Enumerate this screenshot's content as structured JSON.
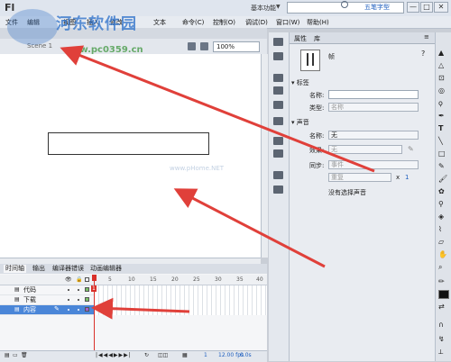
{
  "title_bar": {
    "app_logo": "Fl",
    "workspace": "基本功能",
    "search_label": "五笔字型",
    "window_buttons": [
      "—",
      "□",
      "✕"
    ]
  },
  "menus": [
    "文件",
    "编辑",
    "视图",
    "插入",
    "修改",
    "文本",
    "命令",
    "控制",
    "调试",
    "窗口",
    "帮助"
  ],
  "visible_menus": [
    "命令(C)",
    "控制(O)",
    "调试(D)",
    "窗口(W)",
    "帮助(H)"
  ],
  "watermark": {
    "text": "河东软件园",
    "url": "www.pc0359.cn",
    "faint": "www.pHome.NET"
  },
  "stage": {
    "scene_label": "Scene 1",
    "zoom": "100%"
  },
  "timeline": {
    "tabs": [
      "时间轴",
      "输出",
      "编译器错误",
      "动画编辑器"
    ],
    "layers": [
      {
        "name": "代码",
        "selected": false
      },
      {
        "name": "下载",
        "selected": false
      },
      {
        "name": "内容",
        "selected": true
      }
    ],
    "frame_numbers": [
      "5",
      "10",
      "15",
      "20",
      "25",
      "30",
      "35",
      "40"
    ],
    "current_frame": "1",
    "fps": "12.00",
    "fps_unit": "fps",
    "time": "0.0s"
  },
  "properties": {
    "tabs": [
      "属性",
      "库"
    ],
    "object_type": "帧",
    "label_section": "标签",
    "name_label": "名称:",
    "name_placeholder": "",
    "type_label": "类型:",
    "type_value": "名称",
    "sound_section": "声音",
    "sound_name_label": "名称:",
    "sound_name_value": "无",
    "effect_label": "效果:",
    "effect_value": "无",
    "sync_label": "同步:",
    "sync_value": "事件",
    "repeat_value": "重复",
    "repeat_x": "x",
    "repeat_count": "1",
    "no_sound_text": "没有选择声音"
  },
  "colors": {
    "arrow": "#e0403a",
    "playhead": "#d9302a",
    "selected_layer": "#4a86d8"
  }
}
